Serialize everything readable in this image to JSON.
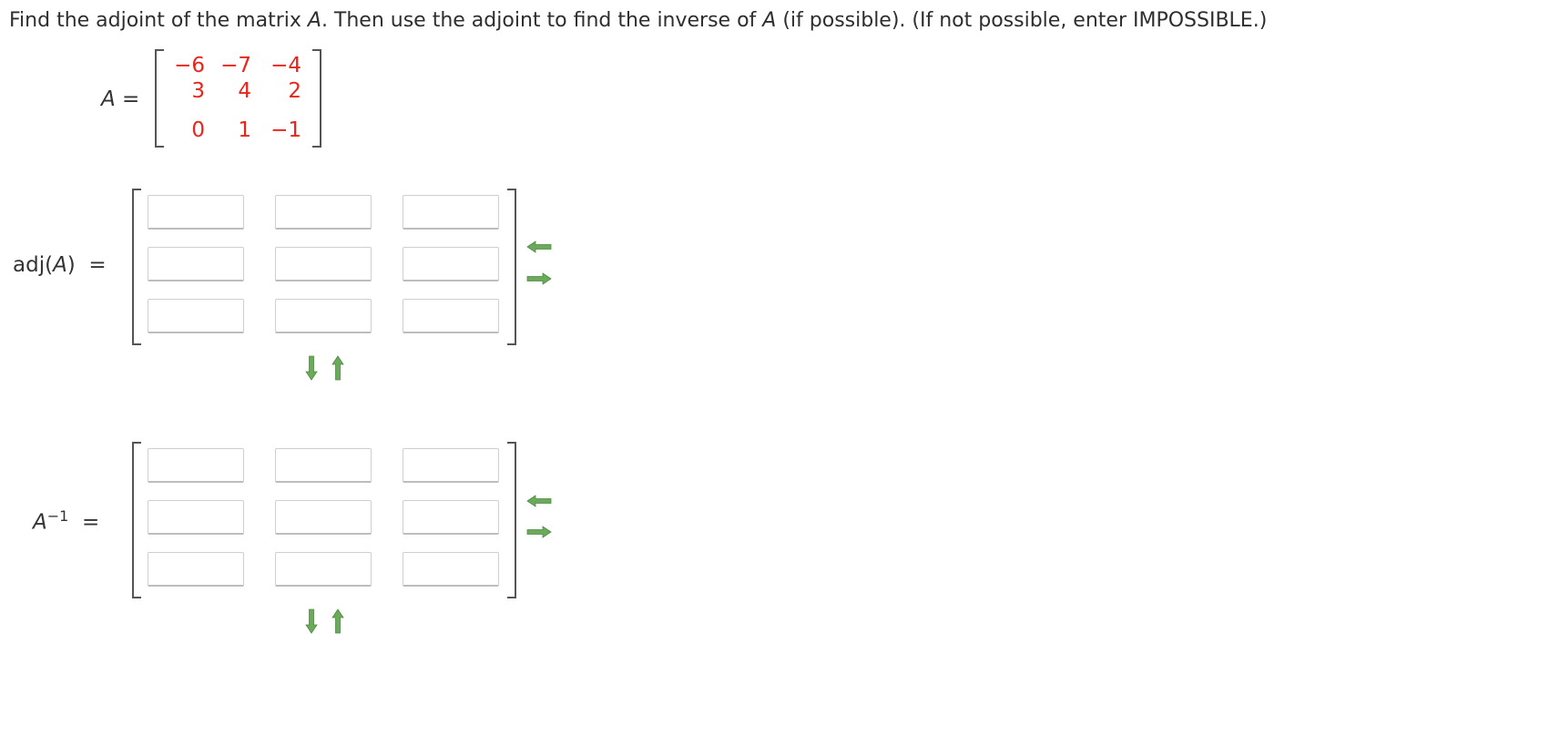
{
  "question": {
    "part1": "Find the adjoint of the matrix ",
    "var1": "A",
    "part2": ". Then use the adjoint to find the inverse of ",
    "var2": "A",
    "part3": " (if possible). (If not possible, enter IMPOSSIBLE.)"
  },
  "matrixA": {
    "label_var": "A",
    "label_eq": "=",
    "rows": [
      [
        "−6",
        "−7",
        "−4"
      ],
      [
        "3",
        "4",
        "2"
      ],
      [
        "0",
        "1",
        "−1"
      ]
    ],
    "value_color": "#e8251c"
  },
  "adj": {
    "label_prefix": "adj(",
    "label_var": "A",
    "label_suffix": ")",
    "label_eq": "=",
    "inputs": [
      [
        "",
        "",
        ""
      ],
      [
        "",
        "",
        ""
      ],
      [
        "",
        "",
        ""
      ]
    ]
  },
  "inverse": {
    "label_var": "A",
    "label_sup": "−1",
    "label_eq": "=",
    "inputs": [
      [
        "",
        "",
        ""
      ],
      [
        "",
        "",
        ""
      ],
      [
        "",
        "",
        ""
      ]
    ]
  },
  "icons": {
    "remove_column": "arrow-left-icon",
    "add_column": "arrow-right-icon",
    "add_row": "arrow-down-icon",
    "remove_row": "arrow-up-icon",
    "arrow_color": "#6aaa5a"
  }
}
